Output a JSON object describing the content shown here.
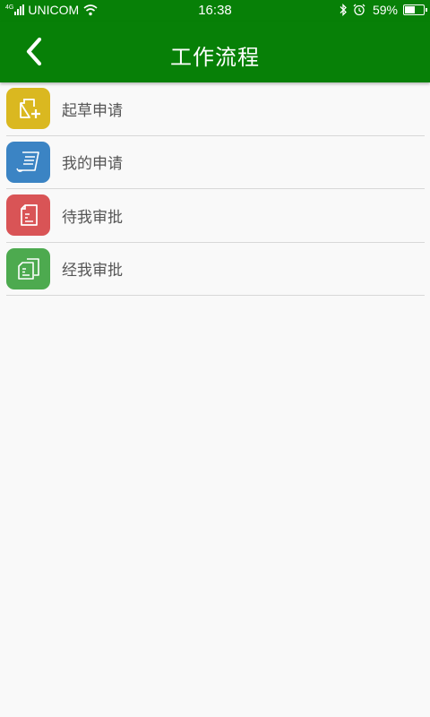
{
  "status_bar": {
    "network": "4G",
    "carrier": "UNICOM",
    "time": "16:38",
    "battery": "59%",
    "battery_level": 0.59
  },
  "header": {
    "title": "工作流程",
    "back_icon": "chevron-left-icon",
    "color": "#078007"
  },
  "menu": [
    {
      "label": "起草申请",
      "icon": "new-document-icon",
      "color": "#dab820"
    },
    {
      "label": "我的申请",
      "icon": "scroll-icon",
      "color": "#3b84c4"
    },
    {
      "label": "待我审批",
      "icon": "document-icon",
      "color": "#d95456"
    },
    {
      "label": "经我审批",
      "icon": "documents-icon",
      "color": "#4daa4f"
    }
  ]
}
